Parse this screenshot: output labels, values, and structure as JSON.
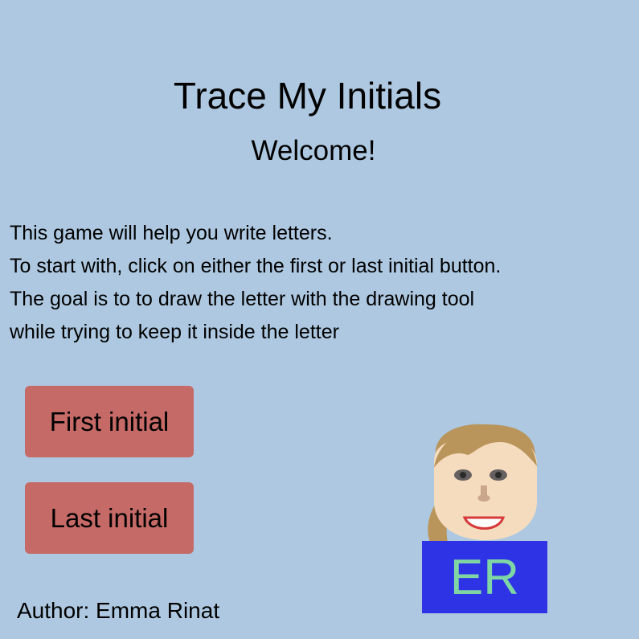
{
  "header": {
    "title": "Trace My Initials",
    "subtitle": "Welcome!"
  },
  "instructions": {
    "lines": [
      "This game will help you write letters.",
      "To start with, click on either the first or last initial button.",
      "The goal is to to draw the letter with the drawing tool",
      "while trying to keep it inside the letter"
    ]
  },
  "buttons": {
    "first_label": "First initial",
    "last_label": "Last initial"
  },
  "avatar": {
    "initials": "ER"
  },
  "footer": {
    "author": "Author: Emma Rinat"
  },
  "colors": {
    "background": "#adc8e0",
    "button": "#c56a66",
    "initials_box": "#2e34e6",
    "initials_text": "#7fd6a4",
    "hair": "#b9955b",
    "skin": "#f5dcbe"
  }
}
